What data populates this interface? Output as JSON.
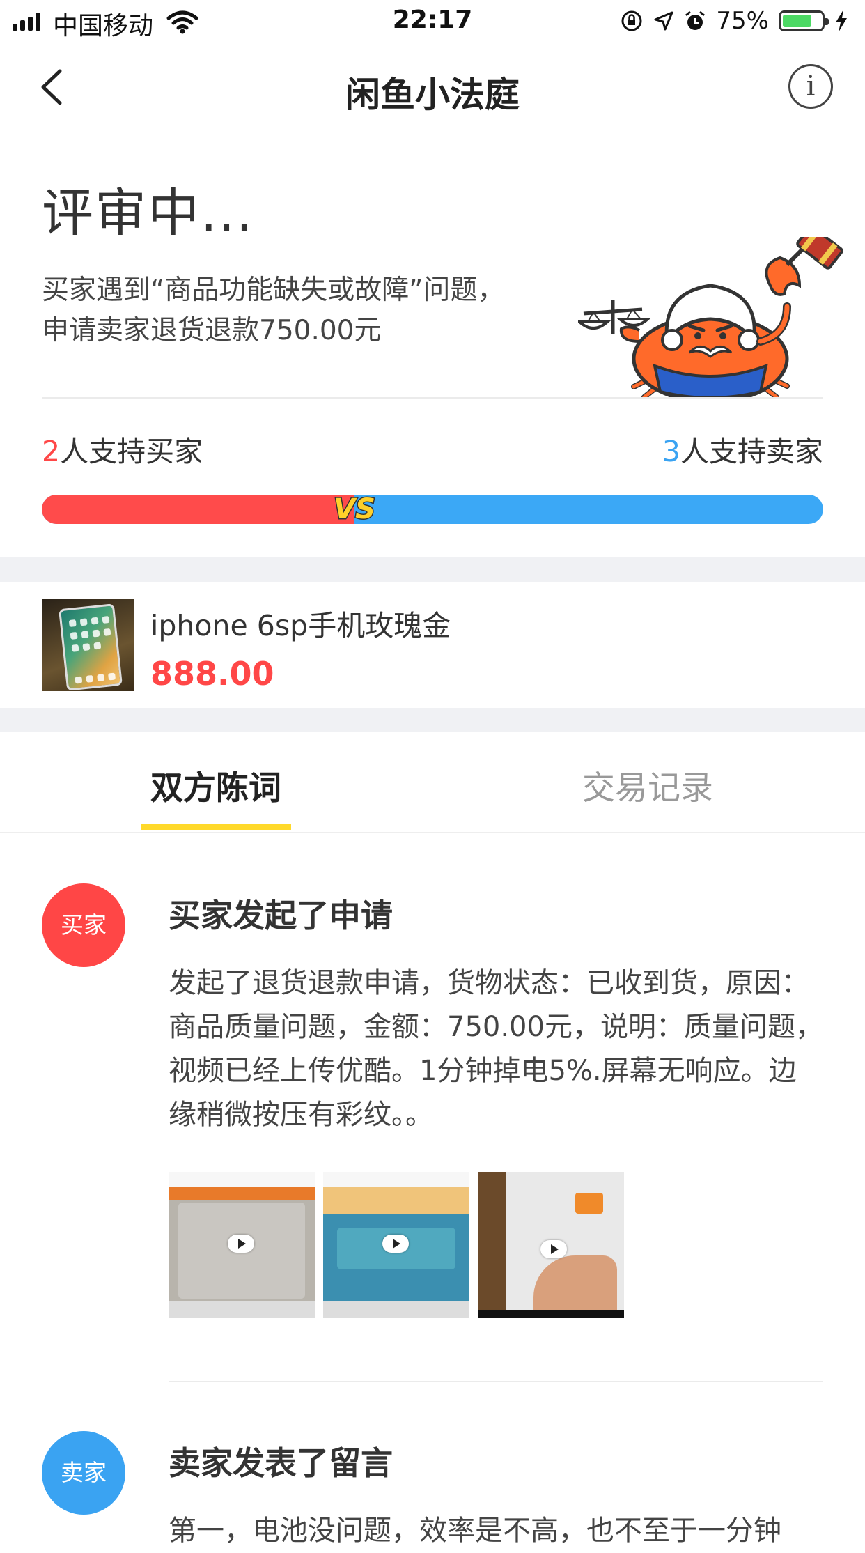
{
  "status_bar": {
    "carrier": "中国移动",
    "time": "22:17",
    "battery": "75%",
    "battery_level": 0.75
  },
  "nav": {
    "title": "闲鱼小法庭",
    "info_glyph": "i"
  },
  "case": {
    "status": "评审中...",
    "summary": "买家遇到“商品功能缺失或故障”问题，申请卖家退货退款750.00元",
    "buyer_support_count": "2",
    "buyer_support_label": "人支持买家",
    "seller_support_count": "3",
    "seller_support_label": "人支持卖家",
    "buyer_share": 0.4,
    "vs_label": "VS"
  },
  "product": {
    "name": "iphone 6sp手机玫瑰金",
    "price": "888.00"
  },
  "tabs": [
    {
      "label": "双方陈词",
      "active": true
    },
    {
      "label": "交易记录",
      "active": false
    }
  ],
  "timeline": [
    {
      "role": "买家",
      "title": "买家发起了申请",
      "body": "发起了退货退款申请，货物状态：已收到货，原因：商品质量问题，金额：750.00元，说明：质量问题，视频已经上传优酷。1分钟掉电5%.屏幕无响应。边缘稍微按压有彩纹。。"
    },
    {
      "role": "卖家",
      "title": "卖家发表了留言",
      "body": "第一，电池没问题，效率是不高，也不至于一分钟"
    }
  ],
  "colors": {
    "buyer": "#ff4646",
    "seller": "#3aa3f2",
    "tab_indicator": "#ffd92a",
    "price": "#ff4747"
  },
  "icons": [
    "signal-icon",
    "wifi-icon",
    "orientation-lock-icon",
    "location-icon",
    "alarm-icon",
    "battery-icon",
    "charging-icon",
    "back-chevron-icon",
    "info-icon",
    "judge-crab-illustration",
    "vs-icon",
    "play-icon"
  ]
}
